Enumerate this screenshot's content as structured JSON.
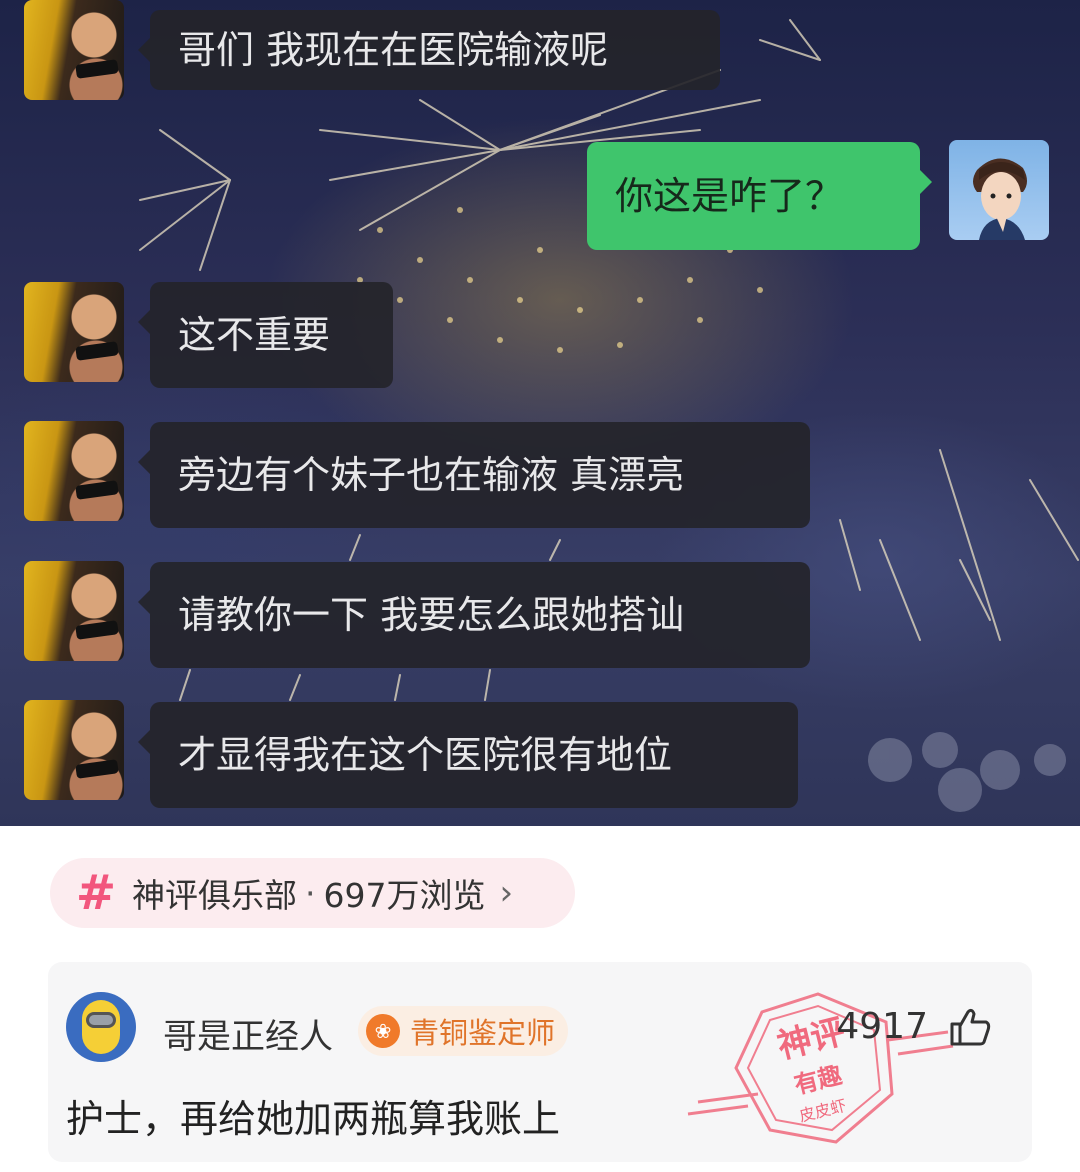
{
  "chat": {
    "messages": [
      {
        "side": "in",
        "text": "哥们 我现在在医院输液呢"
      },
      {
        "side": "out",
        "text": "你这是咋了？"
      },
      {
        "side": "in",
        "text": "这不重要"
      },
      {
        "side": "in",
        "text": "旁边有个妹子也在输液 真漂亮"
      },
      {
        "side": "in",
        "text": "请教你一下 我要怎么跟她搭讪"
      },
      {
        "side": "in",
        "text": "才显得我在这个医院很有地位"
      }
    ]
  },
  "topic": {
    "icon": "hashtag-icon",
    "name": "神评俱乐部",
    "separator": "·",
    "views": "697万浏览",
    "chevron": "›"
  },
  "comment": {
    "username": "哥是正经人",
    "badge_icon": "bronze-medal-icon",
    "badge_label": "青铜鉴定师",
    "likes": "4917",
    "text": "护士，再给她加两瓶算我账上",
    "stamp": {
      "line1": "神评",
      "line2": "有趣",
      "line3": "皮皮虾",
      "color": "#f06a7e"
    }
  }
}
